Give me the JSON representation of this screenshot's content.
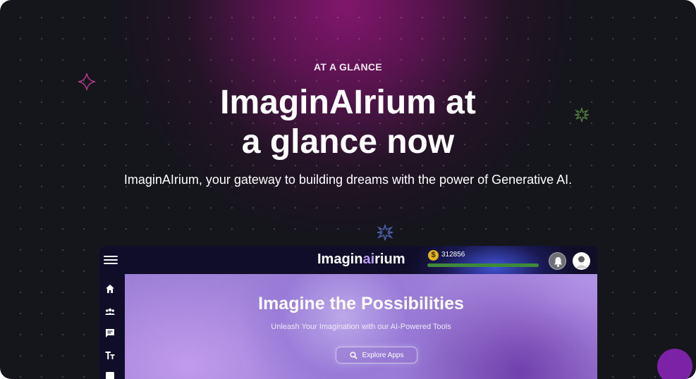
{
  "section": {
    "eyebrow": "AT A GLANCE",
    "headline_line1": "ImaginAIrium at",
    "headline_line2": "a glance now",
    "subheadline": "ImaginAIrium, your gateway to building dreams with the power of Generative AI."
  },
  "app_preview": {
    "logo_prefix": "Imagin",
    "logo_highlight": "ai",
    "logo_suffix": "rium",
    "coin_symbol": "$",
    "credits": "312856",
    "credits_progress": 1.0,
    "hero_title": "Imagine the Possibilities",
    "hero_subtitle": "Unleash Your Imagination with our AI-Powered Tools",
    "explore_button": "Explore Apps",
    "sidebar_icons": [
      "home-icon",
      "community-icon",
      "chat-icon",
      "text-icon",
      "more-icon"
    ],
    "topbar_icons": [
      "menu-icon",
      "coin-icon",
      "bell-icon",
      "user-avatar"
    ]
  },
  "colors": {
    "background": "#15151c",
    "glow": "#871670",
    "accent_purple": "#7b22a7",
    "progress_green": "#3f8a3a",
    "coin_gold": "#e3b526"
  }
}
